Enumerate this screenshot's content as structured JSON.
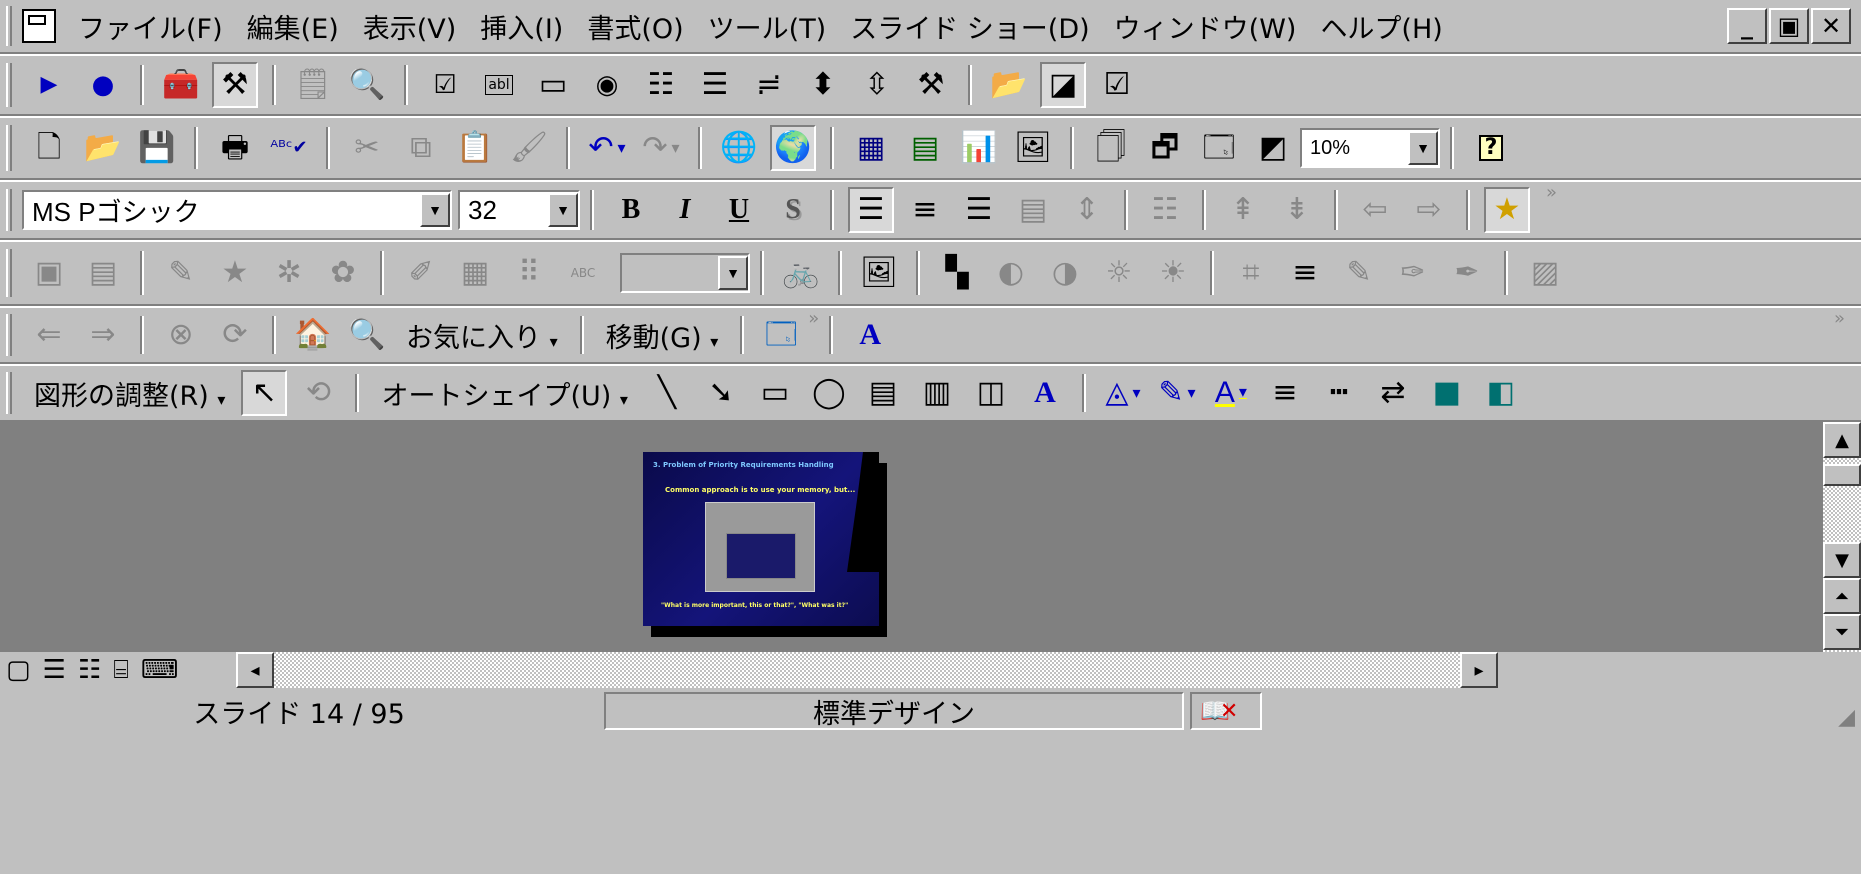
{
  "menubar": {
    "app_icon": "powerpoint-document-icon",
    "items": [
      "ファイル(F)",
      "編集(E)",
      "表示(V)",
      "挿入(I)",
      "書式(O)",
      "ツール(T)",
      "スライド ショー(D)",
      "ウィンドウ(W)",
      "ヘルプ(H)"
    ],
    "window_controls": {
      "minimize": "_",
      "restore": "▣",
      "close": "✕"
    }
  },
  "toolbar_controls": {
    "icons": [
      "run-icon",
      "record-icon",
      "toolbox-icon",
      "design-mode-icon",
      "properties-icon",
      "view-code-icon",
      "checkbox-icon",
      "textbox-icon",
      "command-button-icon",
      "option-button-icon",
      "listbox-icon",
      "combobox-icon",
      "toggle-button-icon",
      "spin-button-icon",
      "scrollbar-icon",
      "more-controls-icon",
      "folder-image-icon",
      "label-icon",
      "checklist-icon"
    ]
  },
  "toolbar_standard": {
    "zoom": "10%",
    "icons": [
      "new-icon",
      "open-icon",
      "save-icon",
      "print-icon",
      "spell-check-icon",
      "cut-icon",
      "copy-icon",
      "paste-icon",
      "format-painter-icon",
      "undo-icon",
      "redo-icon",
      "hyperlink-icon",
      "web-toolbar-icon",
      "insert-table-icon",
      "insert-excel-icon",
      "insert-chart-icon",
      "insert-clipart-icon",
      "new-slide-icon",
      "slide-layout-icon",
      "apply-design-icon",
      "grayscale-icon",
      "help-icon"
    ]
  },
  "toolbar_formatting": {
    "font": "MS Pゴシック",
    "size": "32",
    "bold": "B",
    "italic": "I",
    "underline": "U",
    "shadow": "S",
    "icons": [
      "align-left-icon",
      "align-center-icon",
      "align-right-icon",
      "distribute-icon",
      "vertical-align-icon",
      "bullets-icon",
      "increase-spacing-icon",
      "decrease-spacing-icon",
      "promote-icon",
      "demote-icon",
      "animation-effects-icon"
    ]
  },
  "toolbar_other": {
    "icons": [
      "outline-icon",
      "slide-view-icon",
      "comment-icon",
      "star-icon",
      "stamp-icon",
      "visual-icon",
      "wordart-icon",
      "shape-icon",
      "text-icon",
      "abc-icon",
      "dropdown-icon",
      "auto-check-icon",
      "insert-picture-icon",
      "color-icon",
      "contrast-up-icon",
      "contrast-down-icon",
      "brightness-up-icon",
      "brightness-down-icon",
      "crop-icon",
      "line-style-icon",
      "recolor-icon",
      "format-picture-icon",
      "transparent-icon",
      "reset-picture-icon"
    ]
  },
  "toolbar_web": {
    "favorites": "お気に入り",
    "go": "移動(G)",
    "icons": [
      "back-icon",
      "forward-icon",
      "stop-icon",
      "refresh-icon",
      "home-icon",
      "search-web-icon",
      "show-only-web-toolbar-icon",
      "wordart-a-icon"
    ]
  },
  "toolbar_drawing": {
    "draw": "図形の調整(R)",
    "autoshapes": "オートシェイプ(U)",
    "icons": [
      "select-arrow-icon",
      "rotate-icon",
      "line-icon",
      "arrow-icon",
      "rectangle-icon",
      "oval-icon",
      "textbox-icon",
      "vertical-text-icon",
      "insert-diagram-icon",
      "wordart-icon",
      "fill-color-icon",
      "line-color-icon",
      "font-color-icon",
      "line-style-icon",
      "dash-style-icon",
      "arrow-style-icon",
      "shadow-icon",
      "3d-icon"
    ]
  },
  "slide": {
    "title": "3. Problem of Priority Requirements Handling",
    "line1": "Common approach is to use your memory, but...",
    "line2": "\"What is more important, this or that?\", \"What was it?\""
  },
  "view_buttons": [
    "normal-view-icon",
    "outline-view-icon",
    "slide-sorter-view-icon",
    "notes-page-view-icon",
    "slide-show-view-icon"
  ],
  "status": {
    "slide": "スライド 14 / 95",
    "design": "標準デザイン",
    "spell_icon": "spelling-status-icon"
  }
}
